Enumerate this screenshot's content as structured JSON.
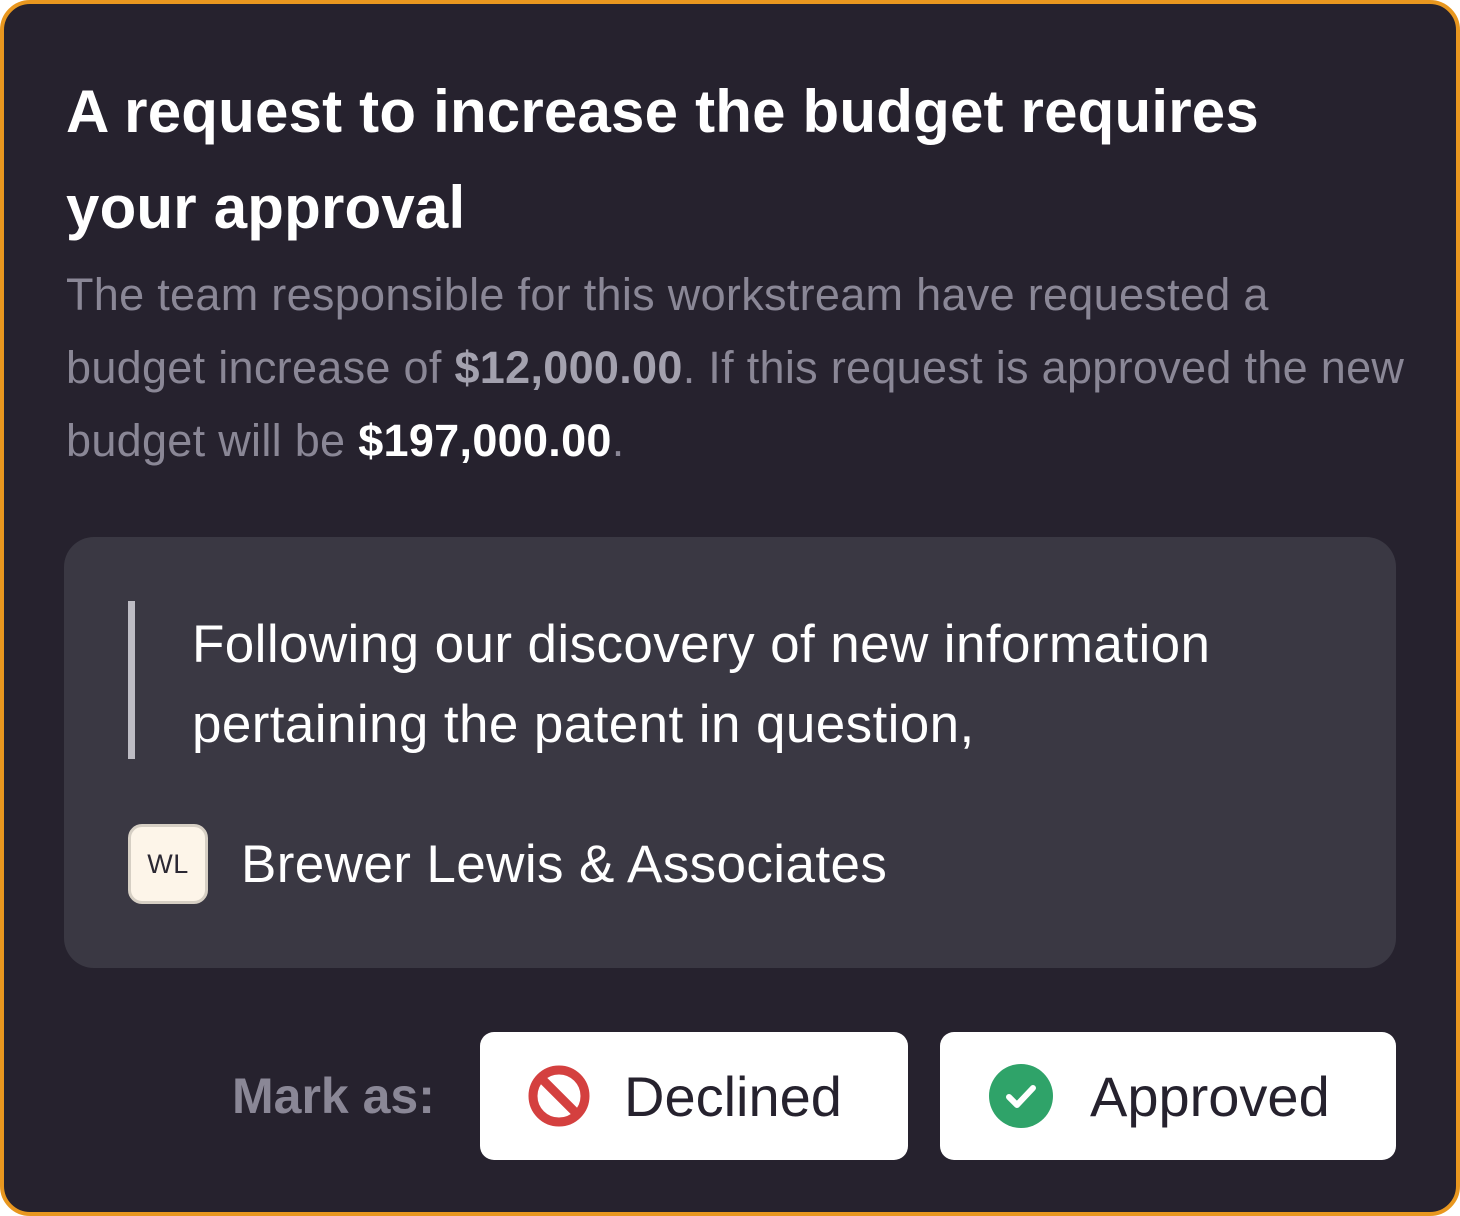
{
  "request": {
    "title": "A request to increase the budget requires your approval",
    "description": {
      "part1": "The team responsible for this workstream have requested a budget increase of ",
      "increase_amount": "$12,000.00",
      "part2": ".  If this request is approved the new budget will be ",
      "new_budget": "$197,000.00",
      "part3": "."
    }
  },
  "quote": {
    "text": "Following our discovery of new information pertaining the patent in question,",
    "author": {
      "initials": "WL",
      "name": "Brewer Lewis & Associates"
    }
  },
  "actions": {
    "mark_label": "Mark as:",
    "declined": {
      "label": "Declined",
      "icon": "prohibited-icon",
      "color": "#d4403f"
    },
    "approved": {
      "label": "Approved",
      "icon": "check-circle-icon",
      "color": "#2fa369"
    }
  },
  "colors": {
    "card_background": "#26222e",
    "card_border": "#e8971f",
    "quote_panel": "#3a3843",
    "muted_text": "#8a8796"
  }
}
